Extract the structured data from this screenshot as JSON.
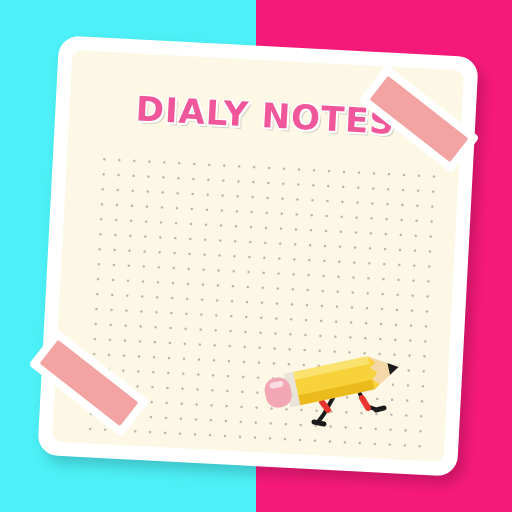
{
  "title": "DIALY NOTES",
  "colors": {
    "background_left": "#4cf0f6",
    "background_right": "#f5197a",
    "paper": "#fdf7e6",
    "title": "#f0579a",
    "tape": "#f4a3a3",
    "dots": "#b9b3a8",
    "pencil_body": "#f8d23a",
    "pencil_eraser": "#f2a8b4",
    "pencil_legs": "#e8352d"
  },
  "icons": {
    "pencil": "walking-pencil-icon"
  }
}
